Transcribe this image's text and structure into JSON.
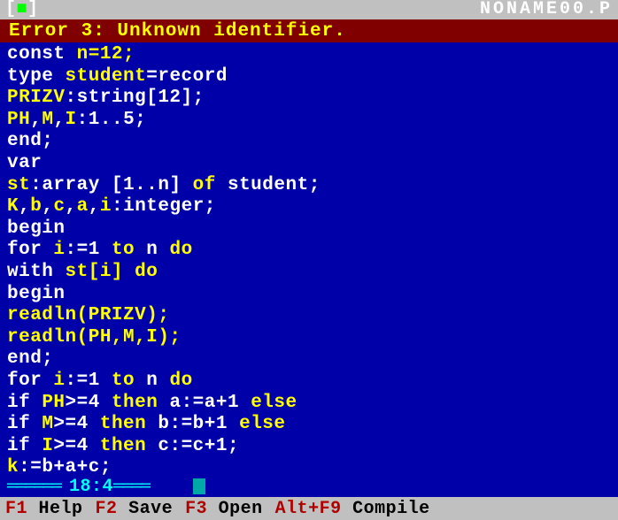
{
  "title": {
    "close_left": "[",
    "close_mid": "■",
    "close_right": "]",
    "filename": "NONAME00.P"
  },
  "error": "Error 3: Unknown identifier.",
  "code": {
    "l1a": "const",
    "l1b": " n=12;",
    "l2a": "type ",
    "l2b": "student",
    "l2c": "=record",
    "l3a": "PRIZV",
    "l3b": ":string[12];",
    "l4a": "PH",
    "l4b": ",",
    "l4c": "M",
    "l4d": ",",
    "l4e": "I",
    "l4f": ":1..5;",
    "l5": "end;",
    "l6": "var",
    "l7a": "st",
    "l7b": ":array [1..n] ",
    "l7c": "of",
    "l7d": " student;",
    "l8a": "K",
    "l8b": ",",
    "l8c": "b",
    "l8d": ",",
    "l8e": "c",
    "l8f": ",",
    "l8g": "a",
    "l8h": ",",
    "l8i": "i",
    "l8j": ":integer;",
    "l9": "begin",
    "l10a": "for ",
    "l10b": "i",
    "l10c": ":=1 ",
    "l10d": "to",
    "l10e": " n ",
    "l10f": "do",
    "l11a": "with ",
    "l11b": "st[i] ",
    "l11c": "do",
    "l12": "begin",
    "l13a": "readln(PRIZV);",
    "l14a": "readln(PH,M,I);",
    "l15": "end;",
    "l16a": "for ",
    "l16b": "i",
    "l16c": ":=1 ",
    "l16d": "to",
    "l16e": " n ",
    "l16f": "do",
    "l17a": "if ",
    "l17b": "PH",
    "l17c": ">=4 ",
    "l17d": "then",
    "l17e": " a:=a+1 ",
    "l17f": "else",
    "l18a": "if ",
    "l18b": "M",
    "l18c": ">=4 ",
    "l18d": "then",
    "l18e": " b:=b+1 ",
    "l18f": "else",
    "l19a": "if ",
    "l19b": "I",
    "l19c": ">=4 ",
    "l19d": "then",
    "l19e": " c:=c+1;",
    "l20a": "k",
    "l20b": ":=b+a+c;"
  },
  "status": {
    "frame": "══════",
    "pos": " 18:4 ",
    "frame2": "════"
  },
  "menu": {
    "k1": "F1",
    "l1": "Help",
    "k2": "F2",
    "l2": "Save",
    "k3": "F3",
    "l3": "Open",
    "k4": "Alt+F9",
    "l4": "Compile"
  }
}
